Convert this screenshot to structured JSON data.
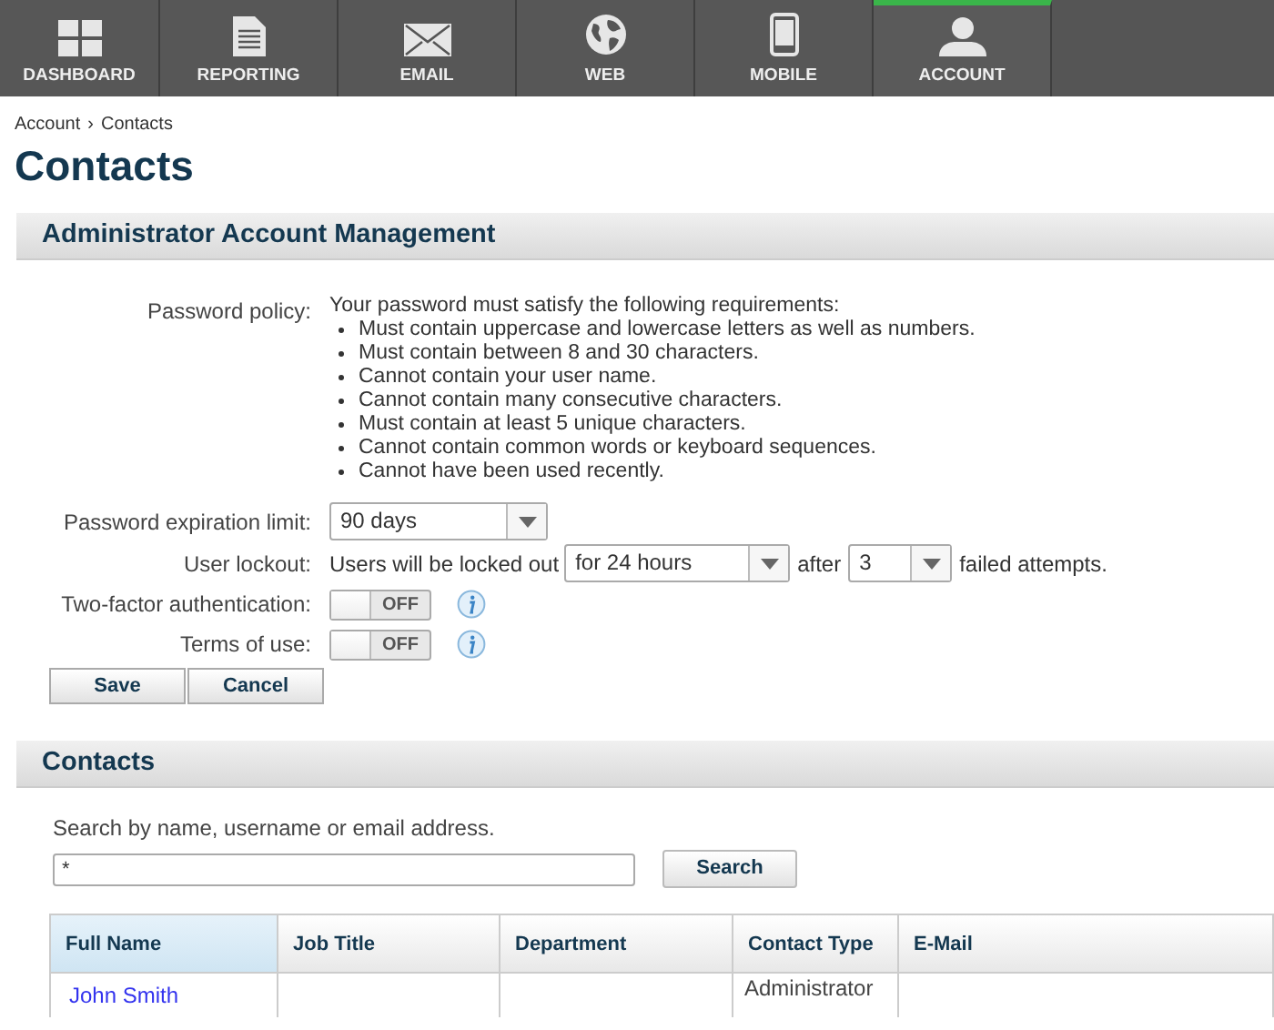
{
  "nav": [
    {
      "label": "DASHBOARD",
      "selected": false
    },
    {
      "label": "REPORTING",
      "selected": false
    },
    {
      "label": "EMAIL",
      "selected": false
    },
    {
      "label": "WEB",
      "selected": false
    },
    {
      "label": "MOBILE",
      "selected": false
    },
    {
      "label": "ACCOUNT",
      "selected": true
    }
  ],
  "breadcrumb": [
    "Account",
    "Contacts"
  ],
  "breadcrumb_separator": "›",
  "page_title": "Contacts",
  "admin_section": {
    "title": "Administrator Account Management",
    "password_policy": {
      "label": "Password policy:",
      "intro": "Your password must satisfy the following requirements:",
      "rules": [
        "Must contain uppercase and lowercase letters as well as numbers.",
        "Must contain between 8 and 30 characters.",
        "Cannot contain your user name.",
        "Cannot contain many consecutive characters.",
        "Must contain at least 5 unique characters.",
        "Cannot contain common words or keyboard sequences.",
        "Cannot have been used recently."
      ]
    },
    "expiration": {
      "label": "Password expiration limit:",
      "value": "90 days"
    },
    "lockout": {
      "label": "User lockout:",
      "before": "Users will be locked out",
      "duration": "for 24 hours",
      "middle": "after",
      "attempts": "3",
      "after": "failed attempts."
    },
    "toggles": [
      {
        "label": "Two-factor authentication:",
        "state_text": "OFF",
        "on": false
      },
      {
        "label": "Terms of use:",
        "state_text": "OFF",
        "on": false
      }
    ],
    "buttons": [
      "Save",
      "Cancel"
    ]
  },
  "contacts_section": {
    "title": "Contacts",
    "search_hint": "Search by name, username or email address.",
    "search_value": "*",
    "search_button": "Search",
    "table": {
      "columns": [
        {
          "label": "Full Name",
          "selected": true
        },
        {
          "label": "Job Title",
          "selected": false
        },
        {
          "label": "Department",
          "selected": false
        },
        {
          "label": "Contact Type",
          "selected": false
        },
        {
          "label": "E-Mail",
          "selected": false
        }
      ],
      "rows": [
        [
          "John Smith",
          "",
          "",
          "Administrator",
          ""
        ]
      ]
    }
  }
}
